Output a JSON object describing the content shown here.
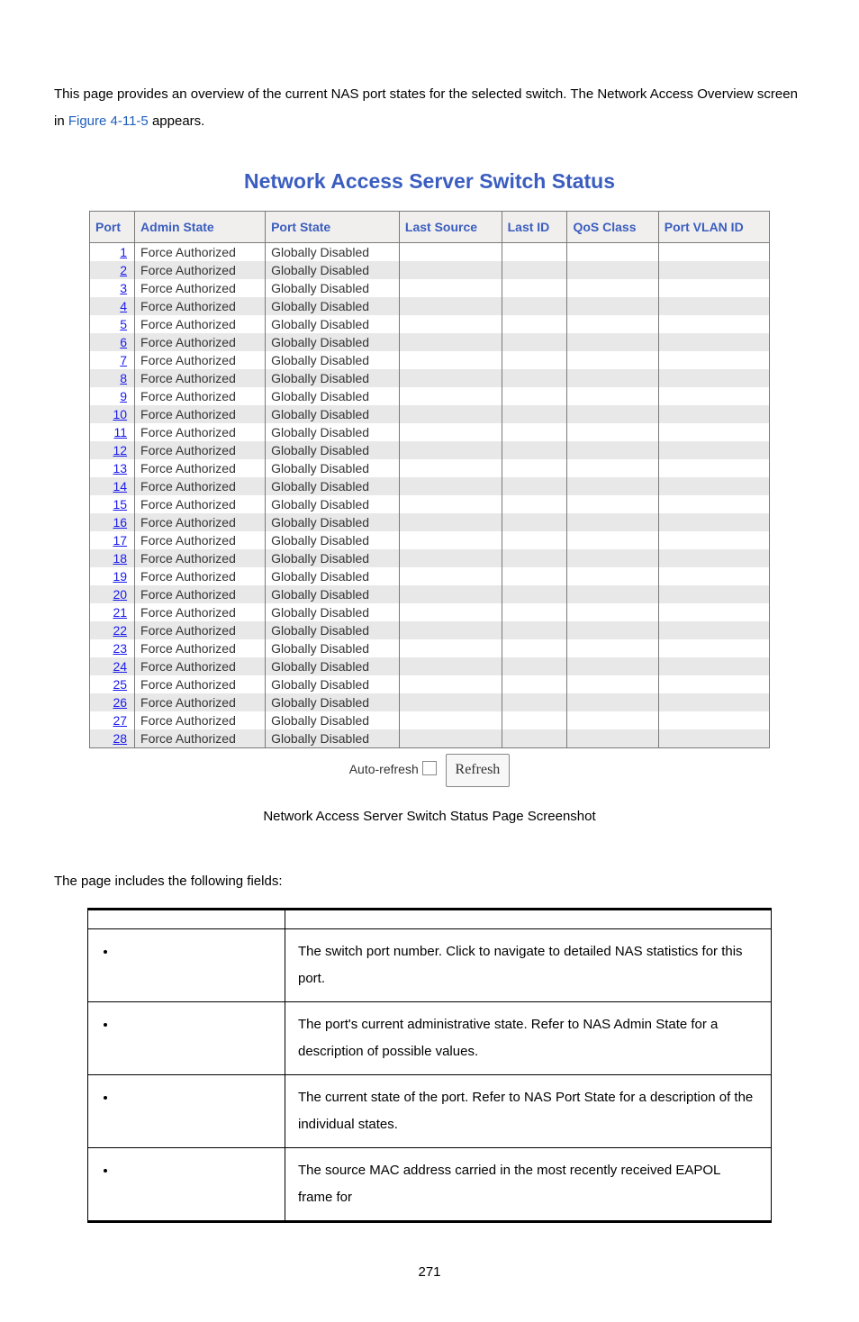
{
  "intro": {
    "line1_a": "This page provides an overview of the current NAS port states for the selected switch. The Network Access Overview screen in ",
    "fig_link": "Figure 4-11-5",
    "line1_b": " appears."
  },
  "chart_data": {
    "type": "table",
    "title": "Network Access Server Switch Status",
    "columns": [
      "Port",
      "Admin State",
      "Port State",
      "Last Source",
      "Last ID",
      "QoS Class",
      "Port VLAN ID"
    ],
    "rows": [
      {
        "port": "1",
        "admin": "Force Authorized",
        "state": "Globally Disabled",
        "last_source": "",
        "last_id": "",
        "qos": "",
        "vlan": ""
      },
      {
        "port": "2",
        "admin": "Force Authorized",
        "state": "Globally Disabled",
        "last_source": "",
        "last_id": "",
        "qos": "",
        "vlan": ""
      },
      {
        "port": "3",
        "admin": "Force Authorized",
        "state": "Globally Disabled",
        "last_source": "",
        "last_id": "",
        "qos": "",
        "vlan": ""
      },
      {
        "port": "4",
        "admin": "Force Authorized",
        "state": "Globally Disabled",
        "last_source": "",
        "last_id": "",
        "qos": "",
        "vlan": ""
      },
      {
        "port": "5",
        "admin": "Force Authorized",
        "state": "Globally Disabled",
        "last_source": "",
        "last_id": "",
        "qos": "",
        "vlan": ""
      },
      {
        "port": "6",
        "admin": "Force Authorized",
        "state": "Globally Disabled",
        "last_source": "",
        "last_id": "",
        "qos": "",
        "vlan": ""
      },
      {
        "port": "7",
        "admin": "Force Authorized",
        "state": "Globally Disabled",
        "last_source": "",
        "last_id": "",
        "qos": "",
        "vlan": ""
      },
      {
        "port": "8",
        "admin": "Force Authorized",
        "state": "Globally Disabled",
        "last_source": "",
        "last_id": "",
        "qos": "",
        "vlan": ""
      },
      {
        "port": "9",
        "admin": "Force Authorized",
        "state": "Globally Disabled",
        "last_source": "",
        "last_id": "",
        "qos": "",
        "vlan": ""
      },
      {
        "port": "10",
        "admin": "Force Authorized",
        "state": "Globally Disabled",
        "last_source": "",
        "last_id": "",
        "qos": "",
        "vlan": ""
      },
      {
        "port": "11",
        "admin": "Force Authorized",
        "state": "Globally Disabled",
        "last_source": "",
        "last_id": "",
        "qos": "",
        "vlan": ""
      },
      {
        "port": "12",
        "admin": "Force Authorized",
        "state": "Globally Disabled",
        "last_source": "",
        "last_id": "",
        "qos": "",
        "vlan": ""
      },
      {
        "port": "13",
        "admin": "Force Authorized",
        "state": "Globally Disabled",
        "last_source": "",
        "last_id": "",
        "qos": "",
        "vlan": ""
      },
      {
        "port": "14",
        "admin": "Force Authorized",
        "state": "Globally Disabled",
        "last_source": "",
        "last_id": "",
        "qos": "",
        "vlan": ""
      },
      {
        "port": "15",
        "admin": "Force Authorized",
        "state": "Globally Disabled",
        "last_source": "",
        "last_id": "",
        "qos": "",
        "vlan": ""
      },
      {
        "port": "16",
        "admin": "Force Authorized",
        "state": "Globally Disabled",
        "last_source": "",
        "last_id": "",
        "qos": "",
        "vlan": ""
      },
      {
        "port": "17",
        "admin": "Force Authorized",
        "state": "Globally Disabled",
        "last_source": "",
        "last_id": "",
        "qos": "",
        "vlan": ""
      },
      {
        "port": "18",
        "admin": "Force Authorized",
        "state": "Globally Disabled",
        "last_source": "",
        "last_id": "",
        "qos": "",
        "vlan": ""
      },
      {
        "port": "19",
        "admin": "Force Authorized",
        "state": "Globally Disabled",
        "last_source": "",
        "last_id": "",
        "qos": "",
        "vlan": ""
      },
      {
        "port": "20",
        "admin": "Force Authorized",
        "state": "Globally Disabled",
        "last_source": "",
        "last_id": "",
        "qos": "",
        "vlan": ""
      },
      {
        "port": "21",
        "admin": "Force Authorized",
        "state": "Globally Disabled",
        "last_source": "",
        "last_id": "",
        "qos": "",
        "vlan": ""
      },
      {
        "port": "22",
        "admin": "Force Authorized",
        "state": "Globally Disabled",
        "last_source": "",
        "last_id": "",
        "qos": "",
        "vlan": ""
      },
      {
        "port": "23",
        "admin": "Force Authorized",
        "state": "Globally Disabled",
        "last_source": "",
        "last_id": "",
        "qos": "",
        "vlan": ""
      },
      {
        "port": "24",
        "admin": "Force Authorized",
        "state": "Globally Disabled",
        "last_source": "",
        "last_id": "",
        "qos": "",
        "vlan": ""
      },
      {
        "port": "25",
        "admin": "Force Authorized",
        "state": "Globally Disabled",
        "last_source": "",
        "last_id": "",
        "qos": "",
        "vlan": ""
      },
      {
        "port": "26",
        "admin": "Force Authorized",
        "state": "Globally Disabled",
        "last_source": "",
        "last_id": "",
        "qos": "",
        "vlan": ""
      },
      {
        "port": "27",
        "admin": "Force Authorized",
        "state": "Globally Disabled",
        "last_source": "",
        "last_id": "",
        "qos": "",
        "vlan": ""
      },
      {
        "port": "28",
        "admin": "Force Authorized",
        "state": "Globally Disabled",
        "last_source": "",
        "last_id": "",
        "qos": "",
        "vlan": ""
      }
    ]
  },
  "controls": {
    "auto_refresh_label": "Auto-refresh",
    "refresh_label": "Refresh"
  },
  "caption": "Network Access Server Switch Status Page Screenshot",
  "fields_intro": "The page includes the following fields:",
  "fields_table": {
    "header_object": "",
    "header_desc": "",
    "rows": [
      {
        "object": "",
        "desc": "The switch port number. Click to navigate to detailed NAS statistics for this port."
      },
      {
        "object": "",
        "desc": "The port's current administrative state. Refer to NAS Admin State for a description of possible values."
      },
      {
        "object": "",
        "desc": "The current state of the port. Refer to NAS Port State for a description of the individual states."
      },
      {
        "object": "",
        "desc": "The source MAC address carried in the most recently received EAPOL frame for"
      }
    ]
  },
  "page_number": "271"
}
